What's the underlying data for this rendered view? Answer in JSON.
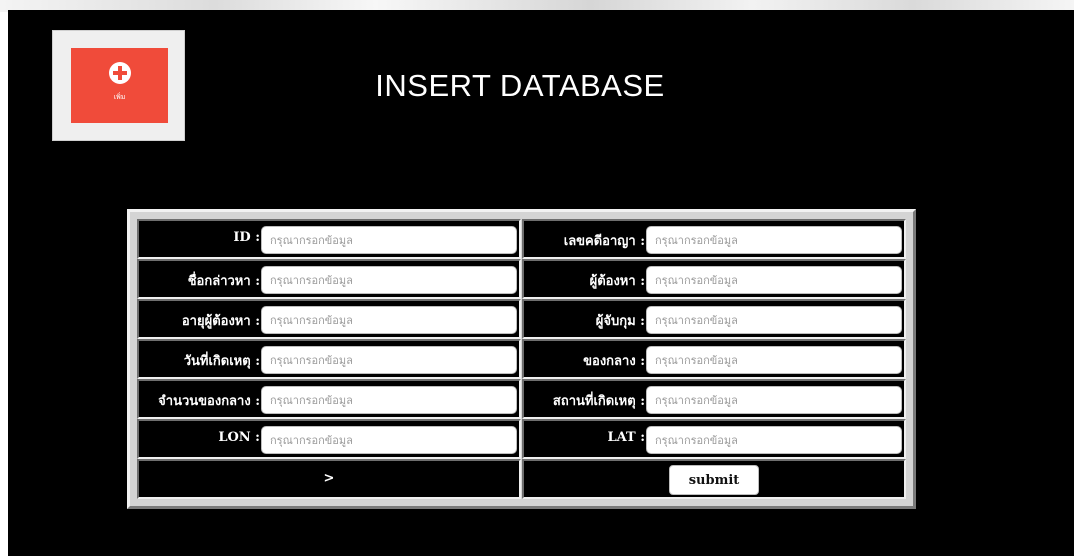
{
  "header": {
    "title": "INSERT DATABASE",
    "add_tile": {
      "icon": "plus-circle-icon",
      "label": "เพิ่ม",
      "accent": "#f04b3a"
    }
  },
  "form": {
    "placeholder": "กรุณากรอกข้อมูล",
    "rows": [
      {
        "left_label": "ID :",
        "right_label": "เลขคดีอาญา :"
      },
      {
        "left_label": "ชื่อกล่าวหา :",
        "right_label": "ผู้ต้องหา :"
      },
      {
        "left_label": "อายุผู้ต้องหา :",
        "right_label": "ผู้จับกุม :"
      },
      {
        "left_label": "วันที่เกิดเหตุ :",
        "right_label": "ของกลาง :"
      },
      {
        "left_label": "จำนวนของกลาง :",
        "right_label": "สถานที่เกิดเหตุ :"
      },
      {
        "left_label": "LON :",
        "right_label": "LAT :"
      }
    ],
    "link_label": ">",
    "submit_label": "submit"
  }
}
